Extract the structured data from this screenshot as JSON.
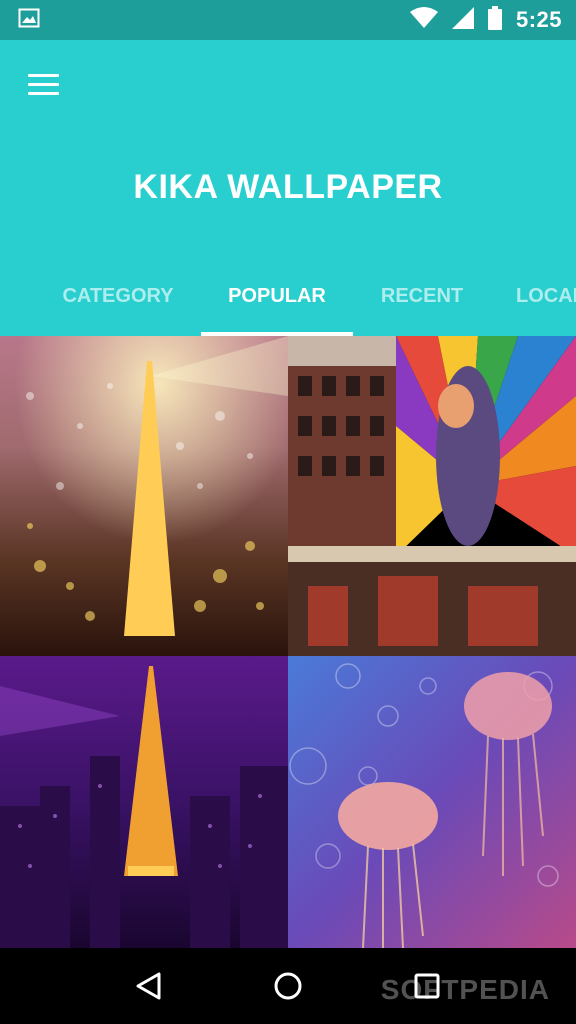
{
  "status_bar": {
    "time": "5:25",
    "icons": [
      "image-icon",
      "wifi-icon",
      "signal-icon",
      "battery-icon"
    ]
  },
  "app_bar": {
    "title": "KIKA WALLPAPER",
    "menu_icon": "hamburger-menu-icon",
    "background": "#29cfcf"
  },
  "tabs": [
    {
      "label": "CATEGORY",
      "active": false
    },
    {
      "label": "POPULAR",
      "active": true
    },
    {
      "label": "RECENT",
      "active": false
    },
    {
      "label": "LOCAL",
      "active": false
    }
  ],
  "wallpapers": [
    {
      "subject": "eiffel-tower-night-raindrops"
    },
    {
      "subject": "street-mural-colorful-kiss"
    },
    {
      "subject": "tokyo-tower-purple-night"
    },
    {
      "subject": "jellyfish-bubbles-galaxy"
    }
  ],
  "nav_bar": {
    "buttons": [
      "back-icon",
      "home-icon",
      "recents-icon"
    ]
  },
  "watermark": "SOFTPEDIA"
}
